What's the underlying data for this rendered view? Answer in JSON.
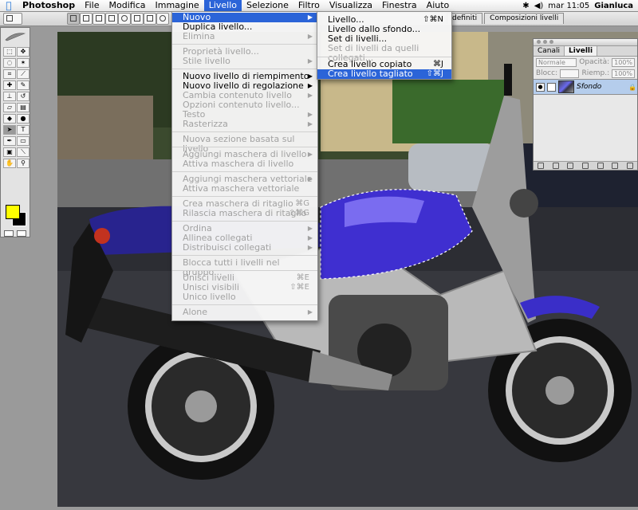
{
  "menubar": {
    "app": "Photoshop",
    "items": [
      "File",
      "Modifica",
      "Immagine",
      "Livello",
      "Selezione",
      "Filtro",
      "Visualizza",
      "Finestra",
      "Aiuto"
    ],
    "active": "Livello",
    "clock": "mar 11:05",
    "user": "Gianluca"
  },
  "dock_tabs": [
    "definiti",
    "Composizioni livelli"
  ],
  "livello_menu": [
    {
      "label": "Nuovo",
      "enabled": true,
      "submenu": true,
      "highlighted": true
    },
    {
      "label": "Duplica livello...",
      "enabled": true
    },
    {
      "label": "Elimina",
      "enabled": false,
      "submenu": true
    },
    {
      "sep": true
    },
    {
      "label": "Proprietà livello...",
      "enabled": false
    },
    {
      "label": "Stile livello",
      "enabled": false,
      "submenu": true
    },
    {
      "sep": true
    },
    {
      "label": "Nuovo livello di riempimento",
      "enabled": true,
      "submenu": true
    },
    {
      "label": "Nuovo livello di regolazione",
      "enabled": true,
      "submenu": true
    },
    {
      "label": "Cambia contenuto livello",
      "enabled": false,
      "submenu": true
    },
    {
      "label": "Opzioni contenuto livello...",
      "enabled": false
    },
    {
      "label": "Testo",
      "enabled": false,
      "submenu": true
    },
    {
      "label": "Rasterizza",
      "enabled": false,
      "submenu": true
    },
    {
      "sep": true
    },
    {
      "label": "Nuova sezione basata sul livello",
      "enabled": false
    },
    {
      "sep": true
    },
    {
      "label": "Aggiungi maschera di livello",
      "enabled": false,
      "submenu": true
    },
    {
      "label": "Attiva maschera  di livello",
      "enabled": false
    },
    {
      "sep": true
    },
    {
      "label": "Aggiungi maschera vettoriale",
      "enabled": false,
      "submenu": true
    },
    {
      "label": "Attiva maschera vettoriale",
      "enabled": false
    },
    {
      "sep": true
    },
    {
      "label": "Crea maschera di ritaglio",
      "enabled": false,
      "shortcut": "⌘G"
    },
    {
      "label": "Rilascia maschera di ritaglio",
      "enabled": false,
      "shortcut": "⇧⌘G"
    },
    {
      "sep": true
    },
    {
      "label": "Ordina",
      "enabled": false,
      "submenu": true
    },
    {
      "label": "Allinea collegati",
      "enabled": false,
      "submenu": true
    },
    {
      "label": "Distribuisci collegati",
      "enabled": false,
      "submenu": true
    },
    {
      "sep": true
    },
    {
      "label": "Blocca tutti i livelli nel gruppo...",
      "enabled": false
    },
    {
      "sep": true
    },
    {
      "label": "Unisci livelli",
      "enabled": false,
      "shortcut": "⌘E"
    },
    {
      "label": "Unisci visibili",
      "enabled": false,
      "shortcut": "⇧⌘E"
    },
    {
      "label": "Unico livello",
      "enabled": false
    },
    {
      "sep": true
    },
    {
      "label": "Alone",
      "enabled": false,
      "submenu": true
    }
  ],
  "nuovo_menu": [
    {
      "label": "Livello...",
      "enabled": true,
      "shortcut": "⇧⌘N"
    },
    {
      "label": "Livello dallo sfondo...",
      "enabled": true
    },
    {
      "label": "Set di livelli...",
      "enabled": true
    },
    {
      "label": "Set di livelli da quelli collegati...",
      "enabled": false
    },
    {
      "sep": true
    },
    {
      "label": "Crea livello copiato",
      "enabled": true,
      "shortcut": "⌘J"
    },
    {
      "label": "Crea livello tagliato",
      "enabled": true,
      "shortcut": "⇧⌘J",
      "highlighted": true
    }
  ],
  "layers_palette": {
    "tabs": [
      "Canali",
      "Livelli"
    ],
    "active_tab": "Livelli",
    "blend_mode": "Normale",
    "opacity_label": "Opacità:",
    "opacity_value": "100%",
    "lock_label": "Blocc:",
    "fill_label": "Riemp.:",
    "fill_value": "100%",
    "layers": [
      {
        "name": "Sfondo",
        "locked": true,
        "selected": true
      }
    ]
  },
  "colors": {
    "accent": "#2b64d8",
    "foreground": "#ffff00",
    "background": "#000000",
    "tank": "#3f2fd0"
  }
}
